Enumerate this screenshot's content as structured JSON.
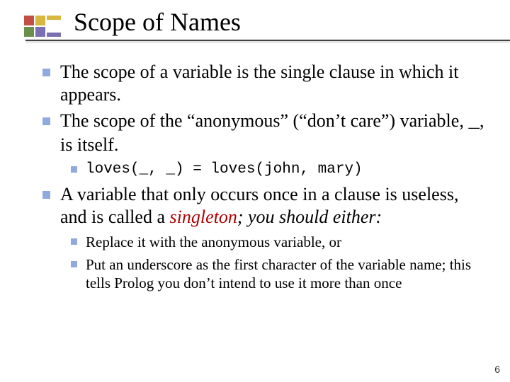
{
  "title": "Scope of Names",
  "bullets": {
    "b1": "The scope of a variable is the single clause in which it appears.",
    "b2_a": "The scope of the “anonymous” (“don’t care”) variable, ",
    "b2_var": "_",
    "b2_b": ", is itself.",
    "b2_sub": "loves(_, _) = loves(john, mary)",
    "b3_a": "A variable that only occurs once in a clause is useless, and is called a ",
    "b3_singleton": "singleton",
    "b3_b": "; you should either:",
    "b3_sub1": "Replace it with the anonymous variable, or",
    "b3_sub2": "Put an underscore as the first character of the variable name; this tells Prolog you don’t intend to use it more than once"
  },
  "page_number": "6"
}
